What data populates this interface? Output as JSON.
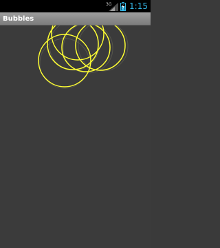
{
  "status_bar": {
    "network_label": "3G",
    "time": "1:15",
    "accent_color": "#33b5e5"
  },
  "app": {
    "title": "Bubbles"
  },
  "canvas": {
    "background_color": "#3b3b3b",
    "bubble_stroke_color": "#ffff33",
    "bubble_count": 5
  }
}
